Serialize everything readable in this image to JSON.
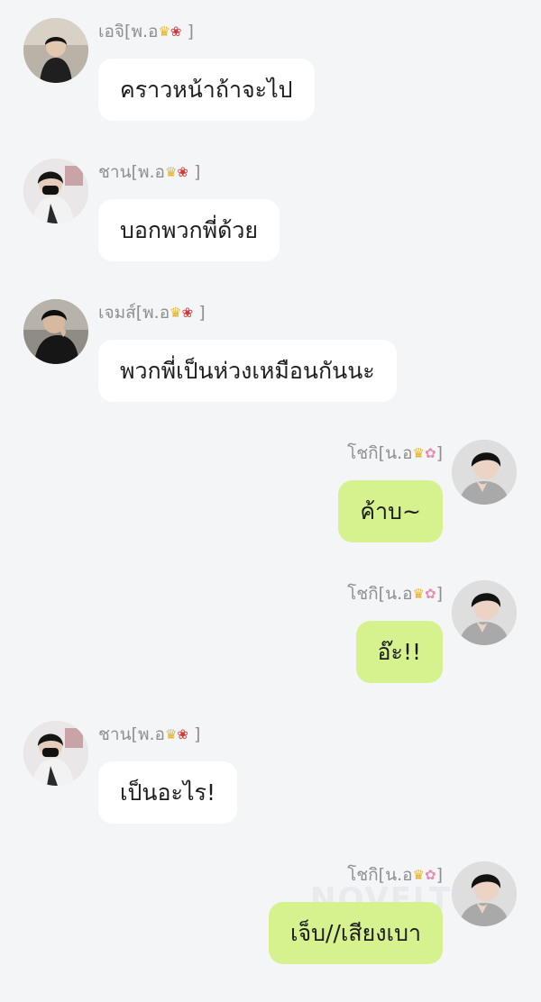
{
  "messages": [
    {
      "side": "left",
      "sender": "เอจิ[พ.อ",
      "tail": "]",
      "emoji": "rose",
      "avatar": "dark",
      "text": "คราวหน้าถ้าจะไป"
    },
    {
      "side": "left",
      "sender": "ชาน[พ.อ",
      "tail": "]",
      "emoji": "rose",
      "avatar": "mask",
      "text": "บอกพวกพี่ด้วย"
    },
    {
      "side": "left",
      "sender": "เจมส์[พ.อ",
      "tail": "]",
      "emoji": "rose",
      "avatar": "black",
      "text": "พวกพี่เป็นห่วงเหมือนกันนะ"
    },
    {
      "side": "right",
      "sender": "โชกิ[น.อ",
      "tail": "]",
      "emoji": "bouquet",
      "avatar": "hand",
      "text": "ค้าบ~"
    },
    {
      "side": "right",
      "sender": "โชกิ[น.อ",
      "tail": "]",
      "emoji": "bouquet",
      "avatar": "hand",
      "text": "อ๊ะ!!"
    },
    {
      "side": "left",
      "sender": "ชาน[พ.อ",
      "tail": "]",
      "emoji": "rose",
      "avatar": "mask",
      "text": "เป็นอะไร!"
    },
    {
      "side": "right",
      "sender": "โชกิ[น.อ",
      "tail": "]",
      "emoji": "bouquet",
      "avatar": "hand",
      "text": "เจ็บ//เสียงเบา"
    }
  ],
  "emoji_glyphs": {
    "crown": "♛",
    "rose": "❀",
    "bouquet": "✿"
  },
  "watermark": "NOVELTO",
  "colors": {
    "background": "#f4f5f7",
    "left_bubble": "#ffffff",
    "right_bubble": "#d6f28e",
    "name": "#8f8f8f"
  }
}
